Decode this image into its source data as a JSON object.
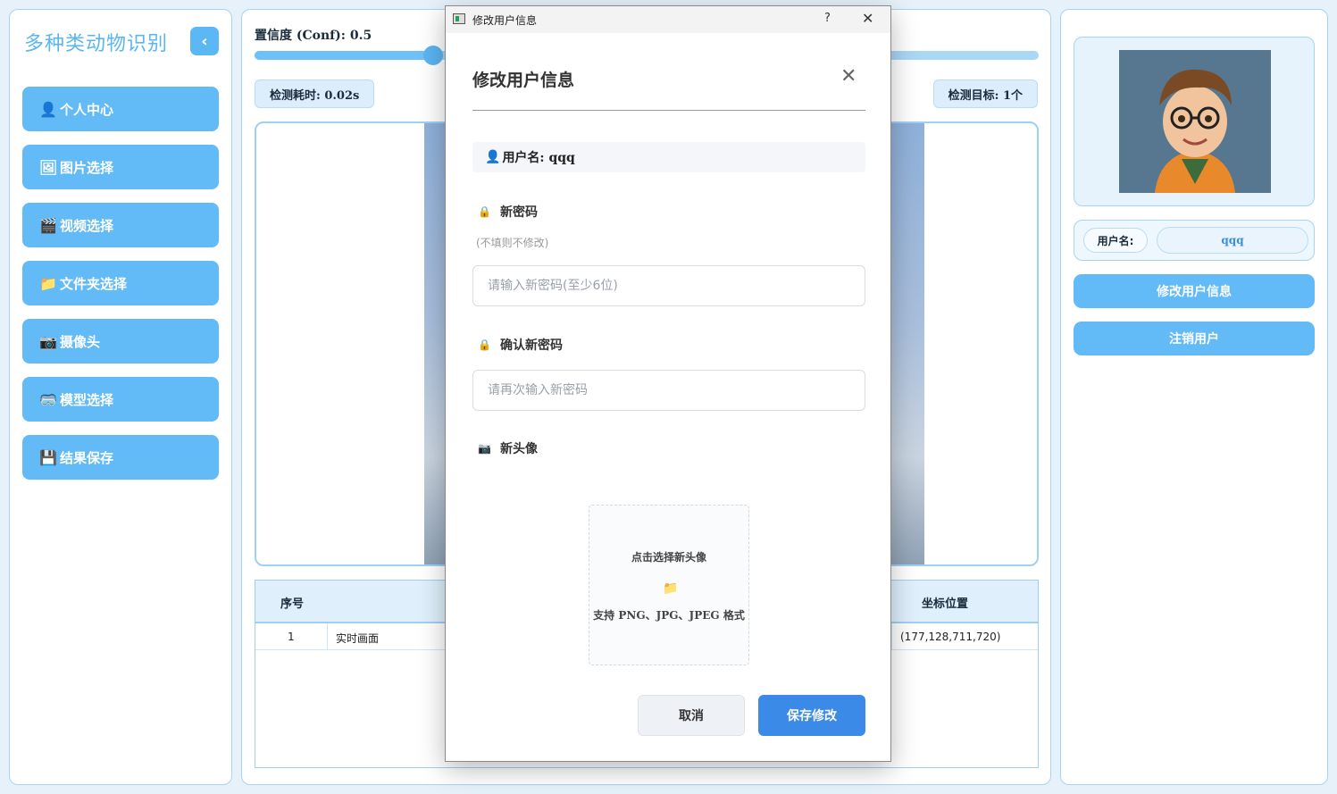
{
  "app": {
    "title": "多种类动物识别",
    "collapse_icon": "chevron-left-icon"
  },
  "sidebar": {
    "items": [
      {
        "icon": "user-icon",
        "glyph": "👤",
        "label": "个人中心"
      },
      {
        "icon": "image-icon",
        "glyph": "🖼",
        "label": "图片选择"
      },
      {
        "icon": "video-icon",
        "glyph": "🎬",
        "label": "视频选择"
      },
      {
        "icon": "folder-icon",
        "glyph": "📁",
        "label": "文件夹选择"
      },
      {
        "icon": "camera-icon",
        "glyph": "📷",
        "label": "摄像头"
      },
      {
        "icon": "model-icon",
        "glyph": "🥽",
        "label": "模型选择"
      },
      {
        "icon": "save-icon",
        "glyph": "💾",
        "label": "结果保存"
      }
    ]
  },
  "center": {
    "conf_label": "置信度 (Conf): 0.5",
    "conf_value": 0.5,
    "detect_time": "检测耗时: 0.02s",
    "detect_count": "检测目标: 1个",
    "table": {
      "headers": [
        "序号",
        "坐标位置"
      ],
      "rows": [
        {
          "index": "1",
          "source": "实时画面",
          "coords": "(177,128,711,720)"
        }
      ]
    }
  },
  "user_panel": {
    "avatar_icon": "cartoon-boy-avatar",
    "username_label": "用户名:",
    "username_value": "qqq",
    "edit_button": "修改用户信息",
    "logout_button": "注销用户"
  },
  "dialog": {
    "window_title": "修改用户信息",
    "help_glyph": "?",
    "close_glyph": "✕",
    "heading": "修改用户信息",
    "heading_close": "✕",
    "username_line": "用户名: qqq",
    "new_password": {
      "label": "新密码",
      "hint": "(不填则不修改)",
      "placeholder": "请输入新密码(至少6位)"
    },
    "confirm_password": {
      "label": "确认新密码",
      "placeholder": "请再次输入新密码"
    },
    "new_avatar": {
      "label": "新头像",
      "upload_title": "点击选择新头像",
      "upload_formats": "支持 PNG、JPG、JPEG 格式"
    },
    "cancel_button": "取消",
    "save_button": "保存修改"
  }
}
